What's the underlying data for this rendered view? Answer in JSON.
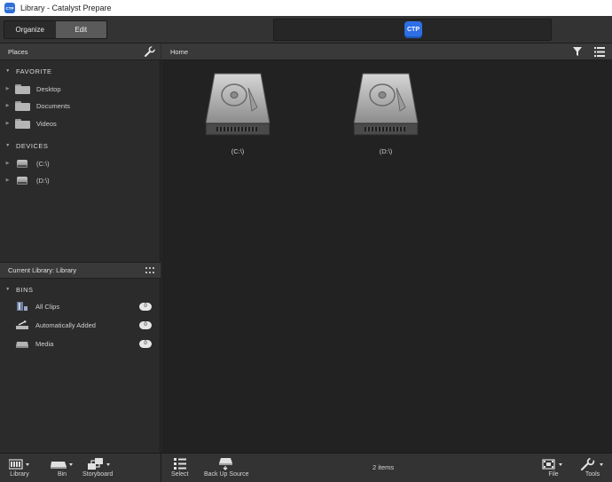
{
  "window": {
    "title": "Library - Catalyst Prepare",
    "app_icon_text": "CTP"
  },
  "toolbar": {
    "organize_label": "Organize",
    "edit_label": "Edit",
    "logo_text": "CTP"
  },
  "places": {
    "header": "Places",
    "favorite_title": "FAVORITE",
    "favorites": [
      {
        "label": "Desktop",
        "icon": "folder-icon"
      },
      {
        "label": "Documents",
        "icon": "folder-icon"
      },
      {
        "label": "Videos",
        "icon": "folder-icon"
      }
    ],
    "devices_title": "DEVICES",
    "devices": [
      {
        "label": "(C:\\)",
        "icon": "drive-icon"
      },
      {
        "label": "(D:\\)",
        "icon": "drive-icon"
      }
    ]
  },
  "library": {
    "header": "Current Library: Library",
    "bins_title": "BINS",
    "bins": [
      {
        "label": "All Clips",
        "count": "0",
        "icon": "clips-icon"
      },
      {
        "label": "Automatically Added",
        "count": "0",
        "icon": "auto-add-icon"
      },
      {
        "label": "Media",
        "count": "0",
        "icon": "media-icon"
      }
    ]
  },
  "main": {
    "breadcrumb": "Home",
    "items": [
      {
        "label": "(C:\\)",
        "icon": "hard-drive-icon"
      },
      {
        "label": "(D:\\)",
        "icon": "hard-drive-icon"
      }
    ]
  },
  "bottombar": {
    "library_label": "Library",
    "bin_label": "Bin",
    "storyboard_label": "Storyboard",
    "select_label": "Select",
    "backup_label": "Back Up Source",
    "status": "2 items",
    "file_label": "File",
    "tools_label": "Tools"
  },
  "colors": {
    "accent": "#2e6fe6",
    "panel": "#2b2b2b",
    "content": "#222222",
    "header": "#393939"
  }
}
